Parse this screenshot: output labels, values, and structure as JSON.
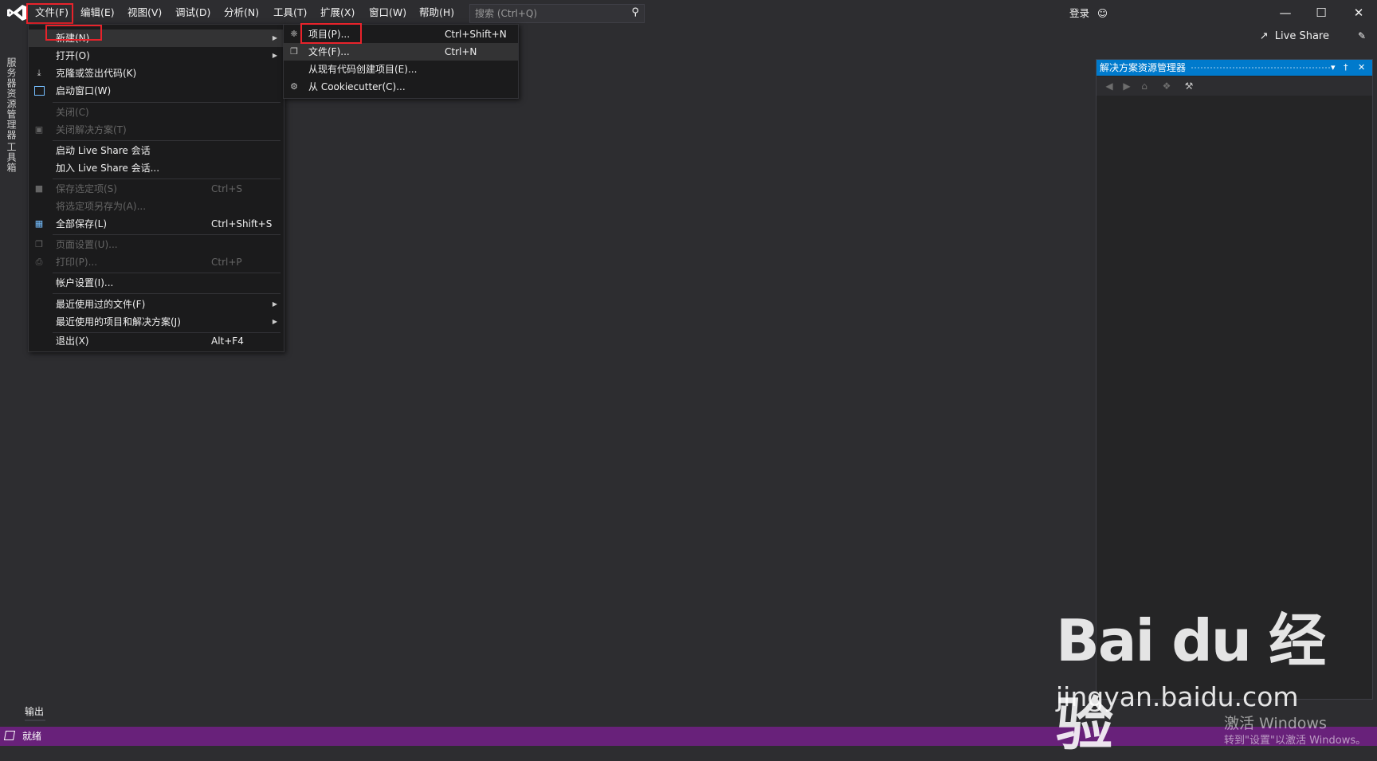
{
  "menubar": {
    "items": [
      "文件(F)",
      "编辑(E)",
      "视图(V)",
      "调试(D)",
      "分析(N)",
      "工具(T)",
      "扩展(X)",
      "窗口(W)",
      "帮助(H)"
    ],
    "search_placeholder": "搜索 (Ctrl+Q)",
    "signin": "登录",
    "live_share": "Live Share"
  },
  "left_tabs": [
    "服务器资源管理器",
    "工具箱"
  ],
  "file_menu": {
    "new": "新建(N)",
    "open": "打开(O)",
    "clone": "克隆或签出代码(K)",
    "start_window": "启动窗口(W)",
    "close": "关闭(C)",
    "close_solution": "关闭解决方案(T)",
    "start_live_share": "启动 Live Share 会话",
    "join_live_share": "加入 Live Share 会话...",
    "save_selected": "保存选定项(S)",
    "save_selected_sc": "Ctrl+S",
    "save_as": "将选定项另存为(A)...",
    "save_all": "全部保存(L)",
    "save_all_sc": "Ctrl+Shift+S",
    "page_setup": "页面设置(U)...",
    "print": "打印(P)...",
    "print_sc": "Ctrl+P",
    "account": "帐户设置(I)...",
    "recent_files": "最近使用过的文件(F)",
    "recent_projects": "最近使用的项目和解决方案(J)",
    "exit": "退出(X)",
    "exit_sc": "Alt+F4"
  },
  "new_menu": {
    "project": "项目(P)...",
    "project_sc": "Ctrl+Shift+N",
    "file": "文件(F)...",
    "file_sc": "Ctrl+N",
    "from_code": "从现有代码创建项目(E)...",
    "cookiecutter": "从 Cookiecutter(C)..."
  },
  "solution_explorer": {
    "title": "解决方案资源管理器"
  },
  "output_tab": "输出",
  "status": "就绪",
  "watermark": {
    "logo": "Bai du 经验",
    "url": "jingyan.baidu.com",
    "activate_title": "激活 Windows",
    "activate_sub": "转到\"设置\"以激活 Windows。"
  },
  "colors": {
    "accent": "#007acc",
    "status": "#68217a",
    "highlight_box": "#e8232b"
  }
}
